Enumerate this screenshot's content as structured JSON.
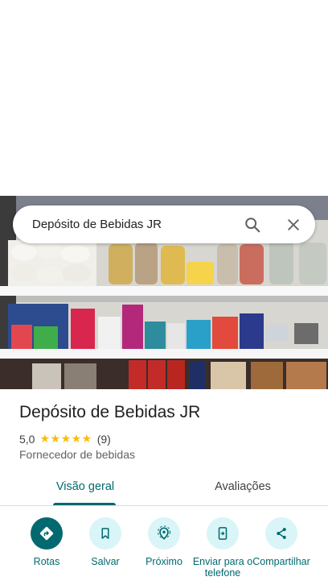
{
  "search": {
    "query": "Depósito de Bebidas JR",
    "search_icon": "search-icon",
    "close_icon": "close-icon"
  },
  "place": {
    "name": "Depósito de Bebidas JR",
    "rating": "5,0",
    "stars": "★★★★★",
    "review_count": "(9)",
    "category": "Fornecedor de bebidas"
  },
  "tabs": [
    {
      "label": "Visão geral",
      "selected": true
    },
    {
      "label": "Avaliações",
      "selected": false
    }
  ],
  "actions": [
    {
      "label": "Rotas",
      "icon": "directions-icon"
    },
    {
      "label": "Salvar",
      "icon": "bookmark-icon"
    },
    {
      "label": "Próximo",
      "icon": "nearby-icon"
    },
    {
      "label": "Enviar para o telefone",
      "icon": "send-to-phone-icon"
    },
    {
      "label": "Compartilhar",
      "icon": "share-icon"
    }
  ],
  "colors": {
    "accent": "#01696f",
    "accent_light": "#d9f5f7",
    "star": "#fbbc04"
  }
}
